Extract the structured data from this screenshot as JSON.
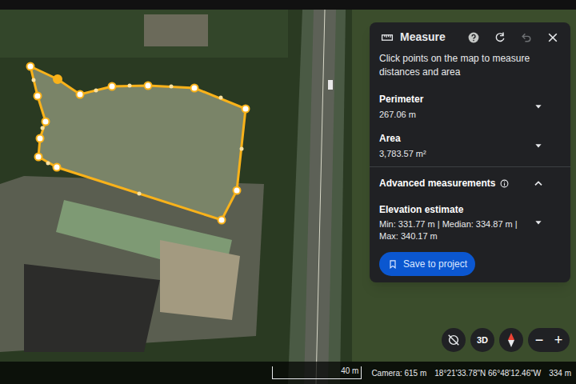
{
  "panel": {
    "title": "Measure",
    "instructions": "Click points on the map to measure distances and area",
    "undo": {
      "disabled": true
    },
    "sections": [
      {
        "label": "Perimeter",
        "value": "267.06 m",
        "expanded": false
      },
      {
        "label": "Area",
        "value": "3,783.57 m²",
        "expanded": false
      }
    ],
    "advanced": {
      "label": "Advanced measurements",
      "expanded": true,
      "items": [
        {
          "label": "Elevation estimate",
          "value": "Min: 331.77 m | Median: 334.87 m | Max: 340.17 m",
          "expanded": false
        }
      ]
    },
    "save_button": "Save to project"
  },
  "map_controls": {
    "view_3d": "3D",
    "zoom_out": "−",
    "zoom_in": "+"
  },
  "status_bar": {
    "scale": "40 m",
    "camera": "Camera: 615 m",
    "coordinates": "18°21'33.78\"N 66°48'12.46\"W",
    "elevation": "334 m"
  }
}
